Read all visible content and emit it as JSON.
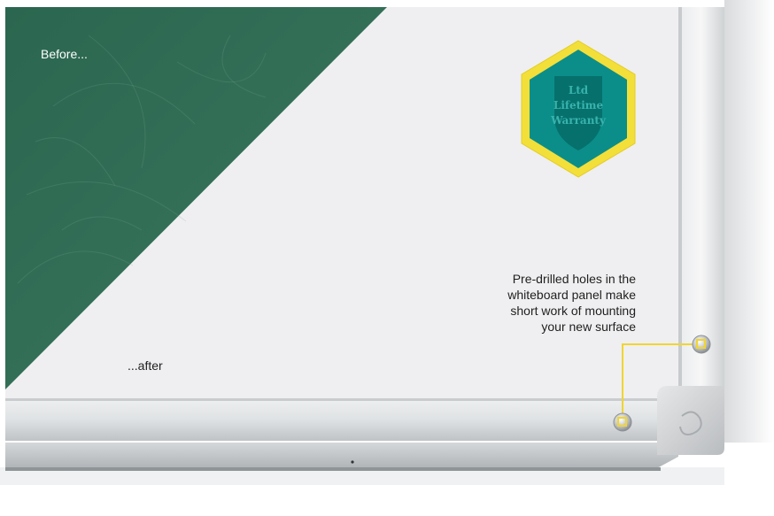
{
  "labels": {
    "before": "Before...",
    "after": "...after"
  },
  "badge": {
    "line1": "Ltd",
    "line2": "Lifetime",
    "line3": "Warranty"
  },
  "callout": {
    "lines": [
      "Pre-drilled holes in the",
      "whiteboard panel make",
      "short work of mounting",
      "your new surface"
    ]
  },
  "colors": {
    "chalkboard_green": "#2f6a52",
    "whiteboard_surface": "#efeff1",
    "frame_aluminium": "#d7d9db",
    "badge_yellow": "#f2df3a",
    "badge_teal": "#0b8e8a",
    "badge_shield": "#06706c",
    "callout_line": "#f1d531",
    "text_dark": "#1f1f1f"
  }
}
